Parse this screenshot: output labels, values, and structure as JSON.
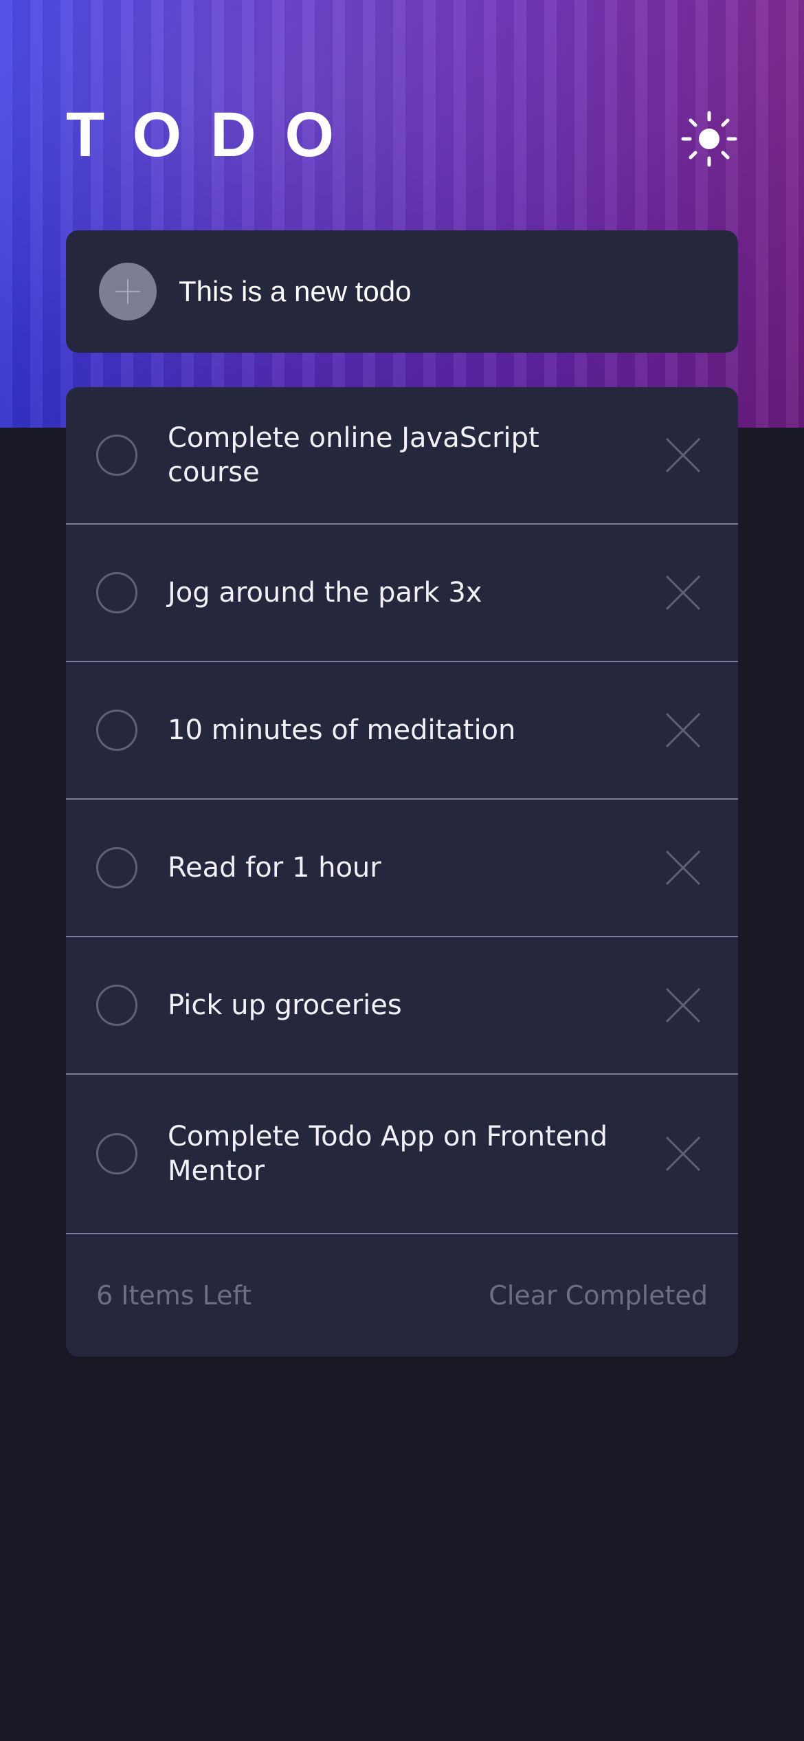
{
  "header": {
    "title": "TODO",
    "theme_icon": "sun-icon"
  },
  "new_todo": {
    "add_icon": "plus-icon",
    "value": "This is a new todo"
  },
  "todos": [
    {
      "text": "Complete online JavaScript course",
      "completed": false
    },
    {
      "text": "Jog around the park 3x",
      "completed": false
    },
    {
      "text": "10 minutes of meditation",
      "completed": false
    },
    {
      "text": "Read for 1 hour",
      "completed": false
    },
    {
      "text": "Pick up groceries",
      "completed": false
    },
    {
      "text": "Complete Todo App on Frontend Mentor",
      "completed": false
    }
  ],
  "footer": {
    "items_left": "6 Items Left",
    "clear_label": "Clear Completed"
  },
  "colors": {
    "background": "#171823",
    "card": "#25273d",
    "text": "#f1f1f8",
    "muted": "#6c6e86",
    "divider": "#7c7f9c"
  }
}
